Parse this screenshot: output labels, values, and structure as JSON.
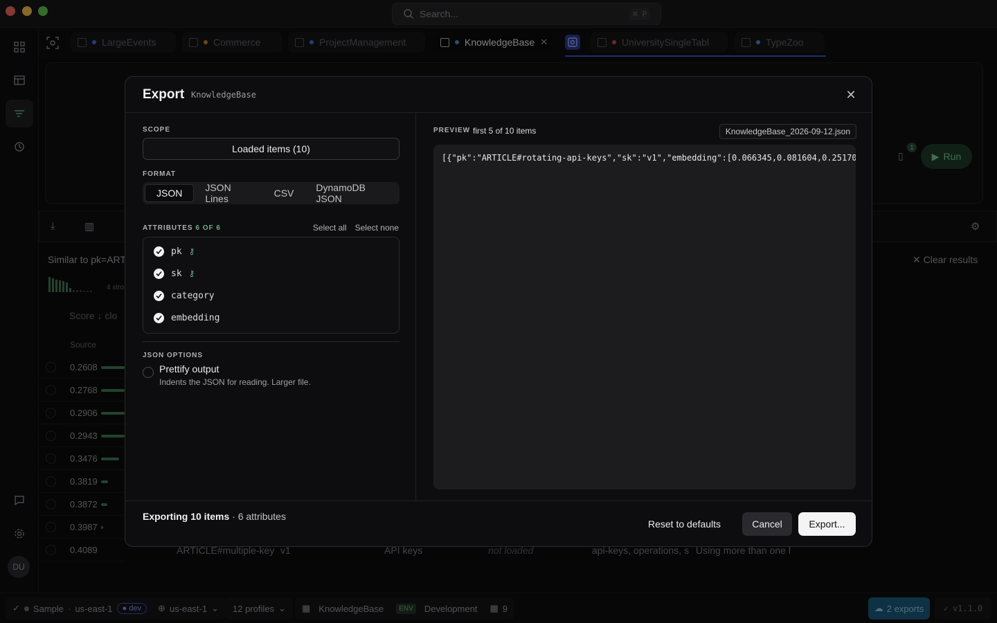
{
  "search": {
    "placeholder": "Search...",
    "shortcut": "⌘ P"
  },
  "tabs": [
    {
      "label": "LargeEvents",
      "dot": "#4a6fd1"
    },
    {
      "label": "Commerce",
      "dot": "#c87c3a"
    },
    {
      "label": "ProjectManagement",
      "dot": "#4a6fd1"
    },
    {
      "label": "KnowledgeBase",
      "dot": "#4a8fd1"
    },
    {
      "label": "UniversitySingleTabl",
      "dot": "#c84a4a"
    },
    {
      "label": "TypeZoo",
      "dot": "#4a8fd1"
    }
  ],
  "background": {
    "similar": "Similar to pk=ART",
    "strong": "4 stro",
    "score_header": "Score ↓ clo",
    "source_header": "Source",
    "clear_results": "Clear results",
    "run": "Run",
    "bookmark_count": "1",
    "last_row": {
      "pk": "ARTICLE#multiple-key",
      "sk": "v1",
      "category": "API keys",
      "embedding": "not loaded",
      "tags": "api-keys, operations, s",
      "text": "Using more than one l"
    },
    "scores": [
      "0.2608",
      "0.2768",
      "0.2906",
      "0.2943",
      "0.3476",
      "0.3819",
      "0.3872",
      "0.3987",
      "0.4089"
    ],
    "bar_fractions": [
      1.0,
      1.0,
      1.0,
      1.0,
      0.75,
      0.3,
      0.25,
      0.1,
      0.0
    ]
  },
  "statusbar": {
    "profile": "Sample",
    "region": "us-east-1",
    "stage": "dev",
    "region2": "us-east-1",
    "profiles": "12 profiles",
    "table": "KnowledgeBase",
    "env_tag": "ENV",
    "env": "Development",
    "count": "9",
    "exports": "2 exports",
    "version": "v1.1.0"
  },
  "sidebar": {
    "avatar": "DU"
  },
  "modal": {
    "title": "Export",
    "subtitle": "KnowledgeBase",
    "scope_label": "SCOPE",
    "scope_value": "Loaded items (10)",
    "format_label": "FORMAT",
    "formats": [
      "JSON",
      "JSON Lines",
      "CSV",
      "DynamoDB JSON"
    ],
    "attributes_label": "ATTRIBUTES",
    "attributes_count": "6 OF 6",
    "select_all": "Select all",
    "select_none": "Select none",
    "attributes": [
      {
        "name": "pk",
        "key": true
      },
      {
        "name": "sk",
        "key": true
      },
      {
        "name": "category",
        "key": false
      },
      {
        "name": "embedding",
        "key": false
      }
    ],
    "json_options_label": "JSON OPTIONS",
    "prettify_title": "Prettify output",
    "prettify_desc": "Indents the JSON for reading. Larger file.",
    "preview_label": "PREVIEW",
    "preview_sub": "first 5 of 10 items",
    "filename": "KnowledgeBase_2026-09-12.json",
    "preview_text": "[{\"pk\":\"ARTICLE#rotating-api-keys\",\"sk\":\"v1\",\"embedding\":[0.066345,0.081604,0.25170",
    "summary_bold": "Exporting 10 items",
    "summary_rest": " · 6 attributes",
    "reset": "Reset to defaults",
    "cancel": "Cancel",
    "export": "Export..."
  }
}
